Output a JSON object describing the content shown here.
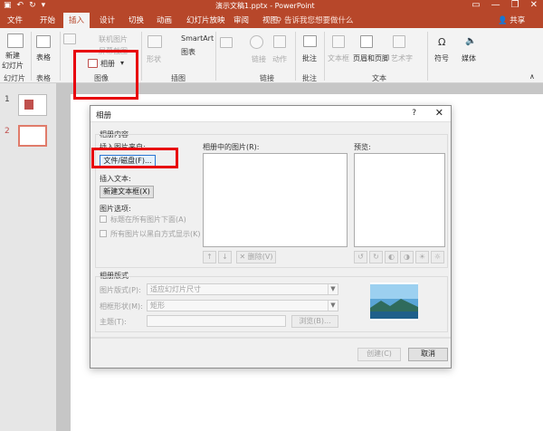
{
  "titlebar": {
    "doc_title": "演示文稿1.pptx - PowerPoint",
    "qat": [
      "▣",
      "↶",
      "↻",
      "▾"
    ],
    "win": [
      "▭",
      "—",
      "❐",
      "✕"
    ]
  },
  "tabs": [
    "文件",
    "开始",
    "插入",
    "设计",
    "切换",
    "动画",
    "幻灯片放映",
    "审阅",
    "视图"
  ],
  "tellme": "告诉我您想要做什么",
  "share": "共享",
  "ribbon": {
    "new_slide": "新建",
    "new_slide2": "幻灯片",
    "slides_group": "幻灯片",
    "table": "表格",
    "tables_group": "表格",
    "online_pictures": "联机图片",
    "screenshot": "屏幕截图",
    "album": "相册",
    "images_group": "图像",
    "shapes": "形状",
    "smartart": "SmartArt",
    "chart": "图表",
    "illustrations_group": "插图",
    "link": "链接",
    "action": "动作",
    "links_group": "链接",
    "comment": "批注",
    "comments_group": "批注",
    "textbox": "文本框",
    "header_footer": "页眉和页脚",
    "wordart": "艺术字",
    "text_group": "文本",
    "symbol": "符号",
    "media": "媒体"
  },
  "thumbs": [
    "1",
    "2"
  ],
  "dialog": {
    "title": "相册",
    "help": "?",
    "close": "✕",
    "album_content": "相册内容",
    "insert_picture_from": "插入图片来自:",
    "file_disk": "文件/磁盘(F)...",
    "insert_text": "插入文本:",
    "new_textbox": "新建文本框(X)",
    "picture_options": "图片选项:",
    "caption_below": "标题在所有图片下面(A)",
    "all_bw": "所有图片以黑白方式显示(K)",
    "pictures_in_album": "相册中的图片(R):",
    "preview": "预览:",
    "delete": "删除(V)",
    "album_layout": "相册版式",
    "picture_layout": "图片版式(P):",
    "picture_layout_value": "适应幻灯片尺寸",
    "frame_shape": "相框形状(M):",
    "frame_shape_value": "矩形",
    "theme": "主题(T):",
    "browse": "浏览(B)...",
    "create": "创建(C)",
    "cancel": "取消"
  }
}
